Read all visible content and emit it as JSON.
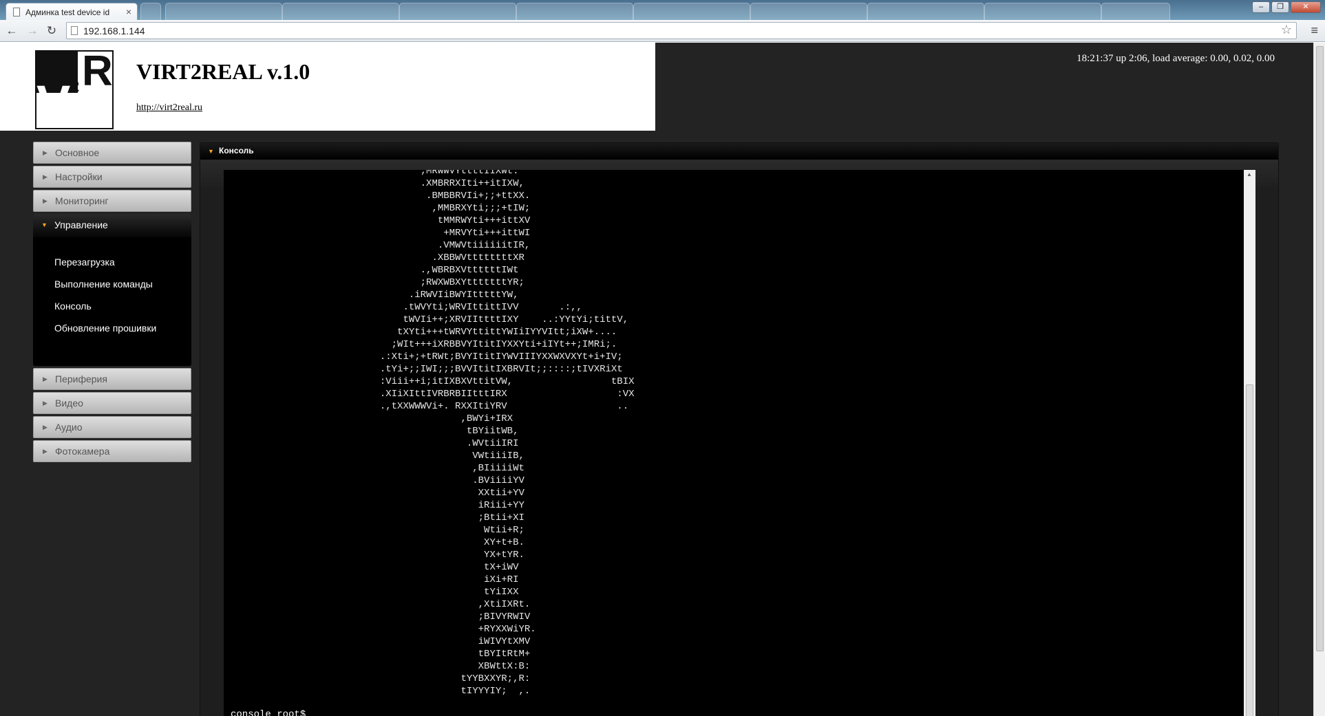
{
  "browser": {
    "active_tab": {
      "title": "Админка test device id",
      "close": "×"
    },
    "url": "192.168.1.144",
    "back": "←",
    "forward": "→",
    "reload": "↻",
    "star": "☆",
    "menu": "≡",
    "window_controls": {
      "minimize": "–",
      "maximize": "❐",
      "close": "✕"
    }
  },
  "header": {
    "title": "VIRT2REAL v.1.0",
    "link": "http://virt2real.ru",
    "status": "18:21:37 up 2:06, load average: 0.00, 0.02, 0.00"
  },
  "sidebar": {
    "arrow_closed": "▶",
    "arrow_open": "▼",
    "items_top": [
      {
        "label": "Основное"
      },
      {
        "label": "Настройки"
      },
      {
        "label": "Мониторинг"
      }
    ],
    "active_group": {
      "label": "Управление",
      "subitems": [
        {
          "label": "Перезагрузка"
        },
        {
          "label": "Выполнение команды"
        },
        {
          "label": "Консоль"
        },
        {
          "label": "Обновление прошивки"
        }
      ]
    },
    "items_bottom": [
      {
        "label": "Периферия"
      },
      {
        "label": "Видео"
      },
      {
        "label": "Аудио"
      },
      {
        "label": "Фотокамера"
      }
    ]
  },
  "console": {
    "title": "Консоль",
    "prompt": "console root$",
    "output": [
      "                                  ;MRWWVYttttIIXWt.",
      "                                  .XMBRRXIti++itIXW,",
      "                                   .BMBBRVIi+;;+ttXX.",
      "                                    ,MMBRXYti;;;+tIW;",
      "                                     tMMRWYti+++ittXV",
      "                                      +MRVYti+++ittWI",
      "                                     .VMWVtiiiiiitIR,",
      "                                    .XBBWVttttttttXR",
      "                                  .,WBRBXVttttttIWt",
      "                                  ;RWXWBXYtttttttYR;",
      "                                .iRWVIiBWYItttttYW,",
      "                               .tWVYti;WRVIttittIVV       .:,,",
      "                               tWVIi++;XRVIIttttIXY    ..:YYtYi;tittV,",
      "                              tXYti+++tWRVYttittYWIiIYYVItt;iXW+....",
      "                             ;WIt+++iXRBBVYItitIYXXYti+iIYt++;IMRi;.",
      "                           .:Xti+;+tRWt;BVYItitIYWVIIIYXXWXVXYt+i+IV;",
      "                           .tYi+;;IWI;;;BVVItitIXBRVIt;;::::;tIVXRiXt",
      "                           :Viii++i;itIXBXVttitVW,                 tBIX",
      "                           .XIiXIttIVRBRBIItttIRX                   :VX",
      "                           .,tXXWWWVi+. RXXItiYRV                   ..",
      "                                         ,BWYi+IRX",
      "                                          tBYiitWB,",
      "                                          .WVtiiIRI",
      "                                           VWtiiiIB,",
      "                                           ,BIiiiiWt",
      "                                           .BViiiiYV",
      "                                            XXtii+YV",
      "                                            iRiii+YY",
      "                                            ;Btii+XI",
      "                                             Wtii+R;",
      "                                             XY+t+B.",
      "                                             YX+tYR.",
      "                                             tX+iWV",
      "                                             iXi+RI",
      "                                             tYiIXX",
      "                                            ,XtiIXRt.",
      "                                            ;BIVYRWIV",
      "                                            +RYXXWiYR.",
      "                                            iWIVYtXMV",
      "                                            tBYItRtM+",
      "                                            XBWttX:B:",
      "                                         tYYBXXYR;,R:",
      "                                         tIYYYIY;  ,."
    ]
  }
}
